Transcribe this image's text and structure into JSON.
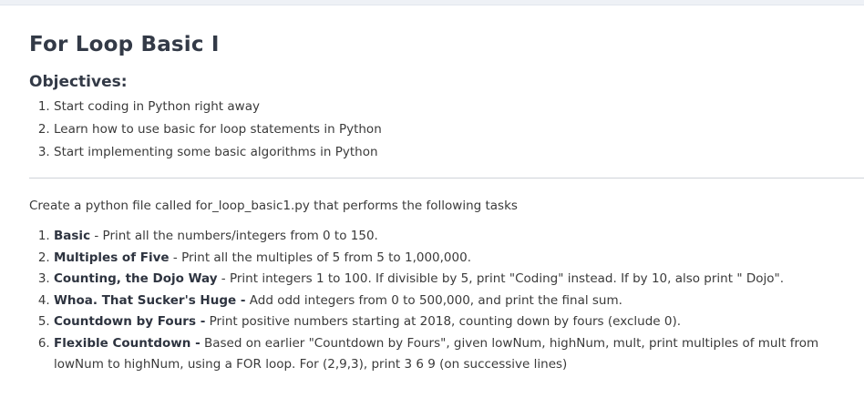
{
  "page": {
    "title": "For Loop Basic I",
    "objectives_heading": "Objectives:",
    "objectives": [
      "Start coding in Python right away",
      "Learn how to use basic for loop statements in Python",
      "Start implementing some basic algorithms in Python"
    ],
    "intro": "Create a python file called for_loop_basic1.py that performs the following tasks",
    "tasks": [
      {
        "name": "Basic",
        "sep": " - ",
        "desc": "Print all the numbers/integers from 0 to 150."
      },
      {
        "name": "Multiples of Five",
        "sep": " - ",
        "desc": "Print all the multiples of 5 from 5 to 1,000,000."
      },
      {
        "name": "Counting, the Dojo Way",
        "sep": " - ",
        "desc": "Print integers 1 to 100.  If divisible by 5, print \"Coding\" instead. If by 10, also print \" Dojo\"."
      },
      {
        "name": "Whoa. That Sucker's Huge -",
        "sep": " ",
        "desc": "Add odd integers from 0 to 500,000, and print the final sum."
      },
      {
        "name": "Countdown by Fours -",
        "sep": " ",
        "desc": "Print positive numbers starting at 2018, counting down by fours (exclude 0)."
      },
      {
        "name": "Flexible Countdown -",
        "sep": " ",
        "desc": "Based on earlier \"Countdown by Fours\", given lowNum, highNum, mult, print multiples of mult from lowNum to highNum, using a FOR loop.  For (2,9,3), print 3 6 9 (on successive lines)"
      }
    ]
  }
}
